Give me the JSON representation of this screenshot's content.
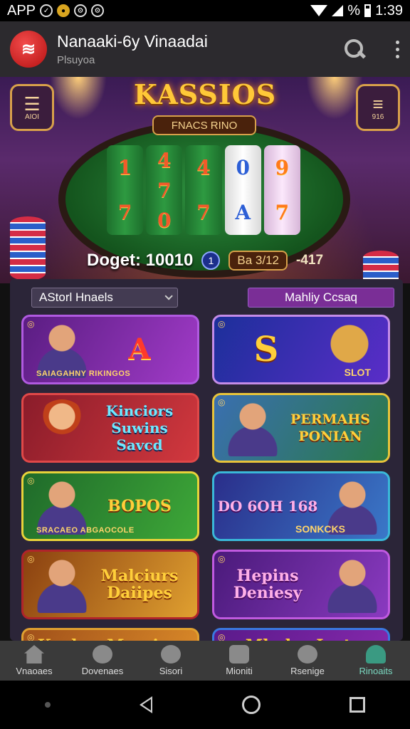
{
  "status_bar": {
    "left_text": "APP",
    "time": "1:39",
    "battery_percent_label": "%",
    "icons": [
      "circle-check-icon",
      "coin-icon",
      "settings-icon",
      "settings-icon",
      "wifi-icon",
      "signal-icon",
      "battery-icon"
    ]
  },
  "app_bar": {
    "title": "Nanaaki-6y Vinaadai",
    "subtitle": "Plsuyoa",
    "logo_icon": "chip-stack-icon",
    "actions": [
      "search-icon",
      "more-vert-icon"
    ]
  },
  "hero": {
    "title": "KASSIOS",
    "banner": "FNACS RINO",
    "left_button_label": "AIOI",
    "left_button_icon": "menu-icon",
    "right_button_label": "916",
    "right_button_icon": "list-icon",
    "reels": [
      [
        "1",
        "7"
      ],
      [
        "4",
        "7",
        "0"
      ],
      [
        "4",
        "7"
      ],
      [
        "0",
        "A"
      ],
      [
        "9",
        "7"
      ]
    ],
    "balance_label": "Doget: 10010",
    "balance_chip": "1",
    "balance_box": "Ba 3/12",
    "balance_extra": "-417"
  },
  "filters": {
    "left": "AStorl Hnaels",
    "right": "Mahliy Ccsaq"
  },
  "games": [
    {
      "title": "A",
      "subtitle": "SAIAGAHNY RIKINGOS",
      "tag": "",
      "icon": "chip-icon"
    },
    {
      "title": "S",
      "subtitle": "",
      "tag": "SLOT",
      "icon": "chip-icon"
    },
    {
      "title": "Kinciors Suwins Savcd",
      "subtitle": "",
      "tag": "",
      "icon": ""
    },
    {
      "title": "PERMAHS PONIAN",
      "subtitle": "",
      "tag": "",
      "icon": "chip-icon"
    },
    {
      "title": "BOPOS",
      "subtitle": "SRACAEO ABGAOCOLE",
      "tag": "",
      "icon": "chip-icon"
    },
    {
      "title": "DO 6OH 168",
      "subtitle": "",
      "tag": "SONKCKS",
      "icon": ""
    },
    {
      "title": "Malciurs Daiipes",
      "subtitle": "",
      "tag": "",
      "icon": "chip-icon"
    },
    {
      "title": "Hepins Deniesy",
      "subtitle": "",
      "tag": "",
      "icon": "chip-icon"
    },
    {
      "title": "Kuykay Macsies",
      "subtitle": "",
      "tag": "",
      "icon": "chip-icon"
    },
    {
      "title": "Mlndnr Inst",
      "subtitle": "",
      "tag": "",
      "icon": "chip-icon"
    }
  ],
  "bottom_nav": [
    {
      "label": "Vnaoaes",
      "icon": "home-icon"
    },
    {
      "label": "Dovenaes",
      "icon": "chip-icon"
    },
    {
      "label": "Sisori",
      "icon": "search-people-icon"
    },
    {
      "label": "Mioniti",
      "icon": "slot-machine-icon"
    },
    {
      "label": "Rsenige",
      "icon": "film-reel-icon"
    },
    {
      "label": "Rinoaits",
      "icon": "person-icon",
      "active": true
    }
  ],
  "colors": {
    "accent_gold": "#ffc838",
    "app_bar": "#2c2a2e",
    "panel": "#2b2538",
    "active_nav": "#7ad8c0"
  }
}
